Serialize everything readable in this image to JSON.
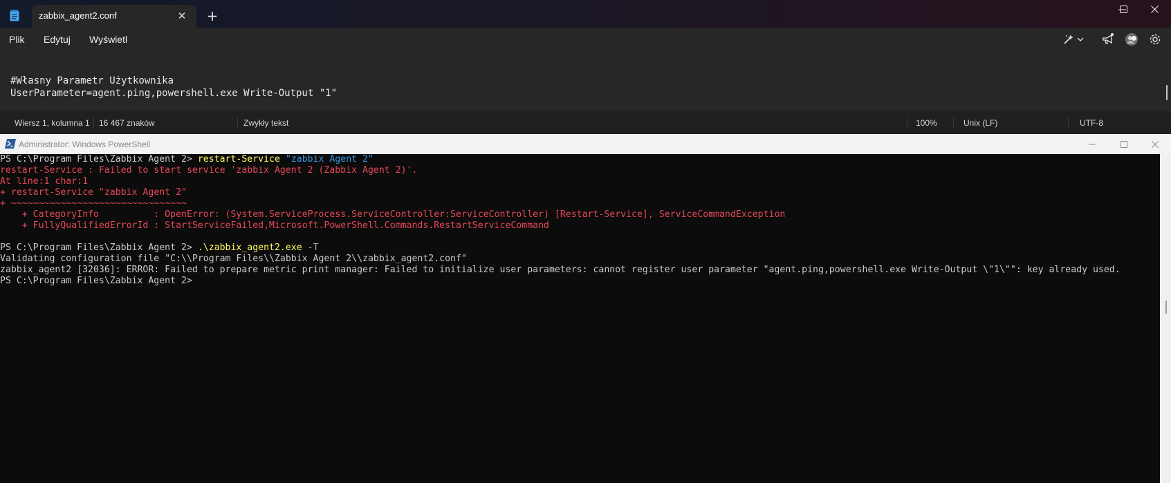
{
  "notepad": {
    "tab_title": "zabbix_agent2.conf",
    "menu": [
      "Plik",
      "Edytuj",
      "Wyświetl"
    ],
    "editor_lines": [
      "#Własny Parametr Użytkownika",
      "UserParameter=agent.ping,powershell.exe Write-Output \"1\""
    ],
    "status": {
      "position": "Wiersz 1, kolumna 1",
      "chars": "16 467 znaków",
      "format": "Zwykły tekst",
      "zoom": "100%",
      "eol": "Unix (LF)",
      "encoding": "UTF-8"
    }
  },
  "powershell": {
    "title": "Administrator: Windows PowerShell",
    "lines": [
      {
        "parts": [
          {
            "t": "PS C:\\Program Files\\Zabbix Agent 2> ",
            "c": "prompt"
          },
          {
            "t": "restart-Service ",
            "c": "cmd"
          },
          {
            "t": "\"zabbix Agent 2\"",
            "c": "str"
          }
        ]
      },
      {
        "parts": [
          {
            "t": "restart-Service : Failed to start service 'zabbix Agent 2 (Zabbix Agent 2)'.",
            "c": "err"
          }
        ]
      },
      {
        "parts": [
          {
            "t": "At line:1 char:1",
            "c": "err"
          }
        ]
      },
      {
        "parts": [
          {
            "t": "+ restart-Service \"zabbix Agent 2\"",
            "c": "err"
          }
        ]
      },
      {
        "parts": [
          {
            "t": "+ ~~~~~~~~~~~~~~~~~~~~~~~~~~~~~~~~",
            "c": "err"
          }
        ]
      },
      {
        "parts": [
          {
            "t": "    + CategoryInfo          : OpenError: (System.ServiceProcess.ServiceController:ServiceController) [Restart-Service], ServiceCommandException",
            "c": "err"
          }
        ]
      },
      {
        "parts": [
          {
            "t": "    + FullyQualifiedErrorId : StartServiceFailed,Microsoft.PowerShell.Commands.RestartServiceCommand",
            "c": "err"
          }
        ]
      },
      {
        "parts": [
          {
            "t": "",
            "c": "prompt"
          }
        ]
      },
      {
        "parts": [
          {
            "t": "PS C:\\Program Files\\Zabbix Agent 2> ",
            "c": "prompt"
          },
          {
            "t": ".\\zabbix_agent2.exe ",
            "c": "cmd"
          },
          {
            "t": "-T",
            "c": "param"
          }
        ]
      },
      {
        "parts": [
          {
            "t": "Validating configuration file \"C:\\\\Program Files\\\\Zabbix Agent 2\\\\zabbix_agent2.conf\"",
            "c": "prompt"
          }
        ]
      },
      {
        "parts": [
          {
            "t": "zabbix_agent2 [32036]: ERROR: Failed to prepare metric print manager: Failed to initialize user parameters: cannot register user parameter \"agent.ping,powershell.exe Write-Output \\\"1\\\"\": key already used.",
            "c": "prompt"
          }
        ]
      },
      {
        "parts": [
          {
            "t": "PS C:\\Program Files\\Zabbix Agent 2>",
            "c": "prompt"
          }
        ]
      }
    ]
  },
  "icons": {
    "notepad_app": "notepad-icon",
    "tab_close": "close-icon",
    "new_tab": "plus-icon",
    "minimize": "minimize-icon",
    "maximize": "maximize-icon",
    "close": "close-icon",
    "copilot": "copilot-icon",
    "whats_new": "megaphone-icon",
    "account": "avatar-icon",
    "settings": "gear-icon",
    "powershell_app": "powershell-icon"
  }
}
